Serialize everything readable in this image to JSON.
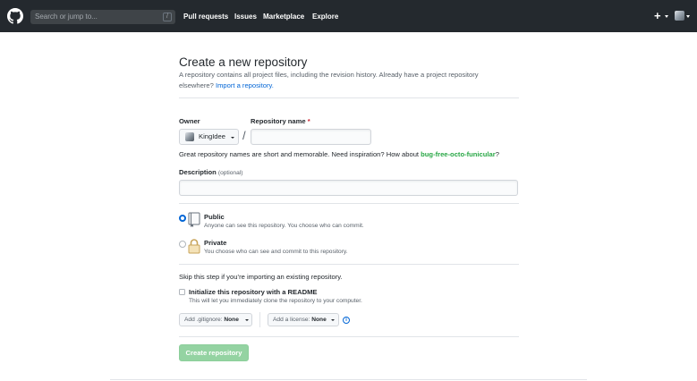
{
  "header": {
    "search_placeholder": "Search or jump to...",
    "search_shortcut": "/",
    "nav": [
      "Pull requests",
      "Issues",
      "Marketplace",
      "Explore"
    ],
    "plus_icon": "+",
    "colors": {
      "bar": "#24292e"
    }
  },
  "page": {
    "title": "Create a new repository",
    "subtitle": "A repository contains all project files, including the revision history. Already have a project repository elsewhere?",
    "import_link": "Import a repository."
  },
  "form": {
    "owner_label": "Owner",
    "owner_value": "KingIdee",
    "slash": "/",
    "repo_label": "Repository name",
    "required_mark": "*",
    "repo_value": "",
    "hint_prefix": "Great repository names are short and memorable. Need inspiration? How about",
    "suggestion": "bug-free-octo-funicular",
    "hint_suffix": "?",
    "description_label": "Description",
    "description_optional": "(optional)",
    "description_value": ""
  },
  "visibility": {
    "public_title": "Public",
    "public_note": "Anyone can see this repository. You choose who can commit.",
    "public_selected": true,
    "private_title": "Private",
    "private_note": "You choose who can see and commit to this repository."
  },
  "init": {
    "skip_note": "Skip this step if you’re importing an existing repository.",
    "readme_title": "Initialize this repository with a README",
    "readme_note": "This will let you immediately clone the repository to your computer.",
    "readme_checked": false,
    "gitignore_prefix": "Add .gitignore:",
    "gitignore_value": "None",
    "license_prefix": "Add a license:",
    "license_value": "None",
    "info_icon": "i"
  },
  "submit": {
    "label": "Create repository",
    "color": "#94d3a2"
  }
}
